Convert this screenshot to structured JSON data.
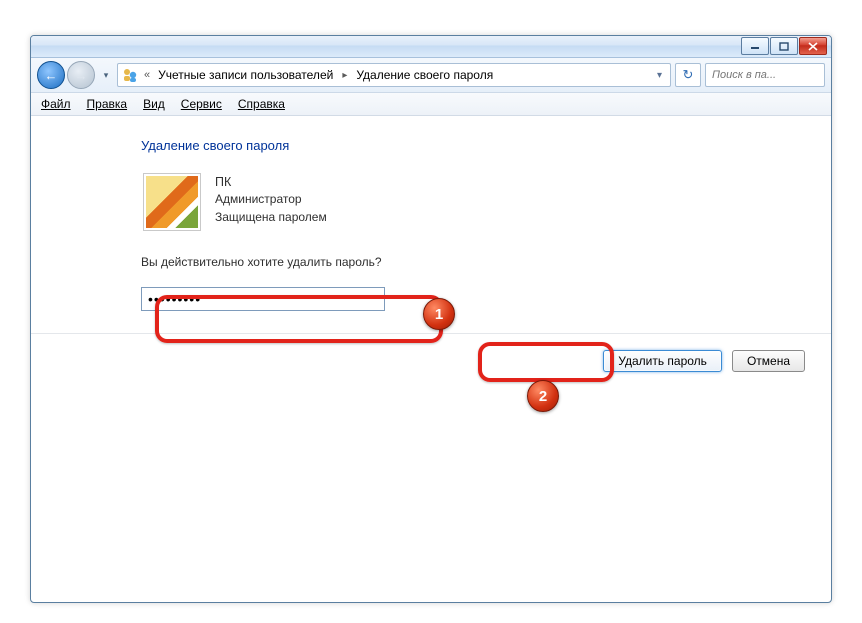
{
  "breadcrumb": {
    "parent": "Учетные записи пользователей",
    "current": "Удаление своего пароля"
  },
  "search": {
    "placeholder": "Поиск в па..."
  },
  "menu": {
    "file": "Файл",
    "edit": "Правка",
    "view": "Вид",
    "tools": "Сервис",
    "help": "Справка"
  },
  "page": {
    "heading": "Удаление своего пароля",
    "user_name": "ПК",
    "user_role": "Администратор",
    "user_protected": "Защищена паролем",
    "prompt": "Вы действительно хотите удалить пароль?",
    "password_value": "•••••••••"
  },
  "buttons": {
    "delete": "Удалить пароль",
    "cancel": "Отмена"
  },
  "callouts": {
    "one": "1",
    "two": "2"
  }
}
